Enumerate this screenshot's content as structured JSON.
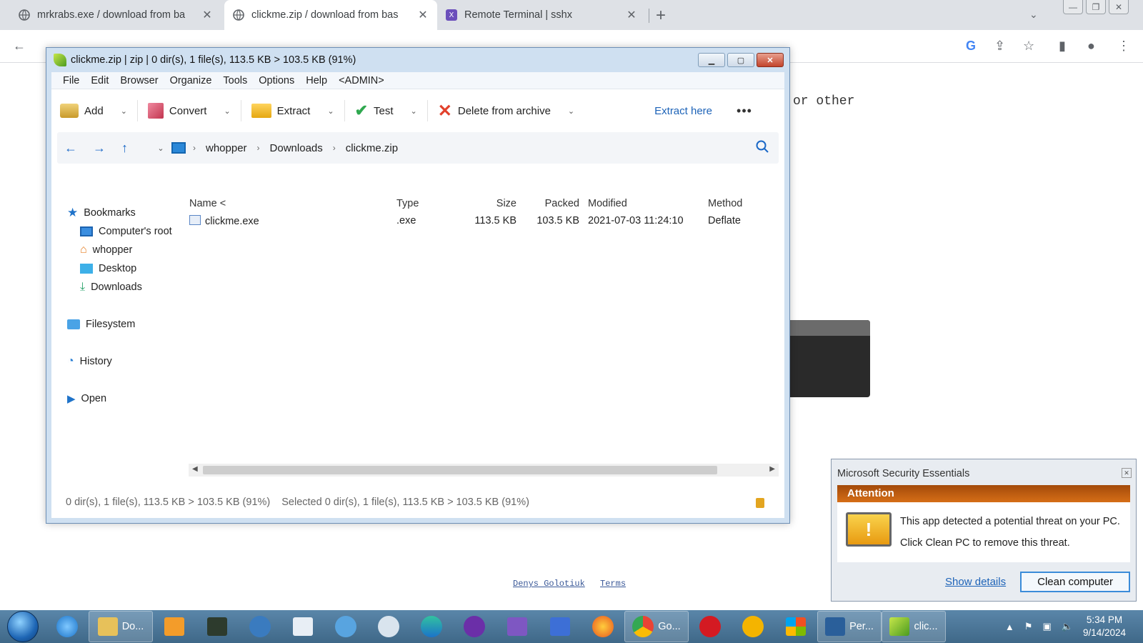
{
  "browser": {
    "tabs": [
      {
        "title": "mrkrabs.exe / download from ba",
        "active": false
      },
      {
        "title": "clickme.zip / download from bas",
        "active": true
      },
      {
        "title": "Remote Terminal | sshx",
        "active": false
      }
    ]
  },
  "page": {
    "partial_text": "or other",
    "footer_links": [
      "Denys Golotiuk",
      "Terms"
    ]
  },
  "archive_window": {
    "title": "clickme.zip | zip | 0 dir(s), 1 file(s), 113.5 KB > 103.5 KB (91%)",
    "menu": [
      "File",
      "Edit",
      "Browser",
      "Organize",
      "Tools",
      "Options",
      "Help",
      "<ADMIN>"
    ],
    "ribbon": {
      "add": "Add",
      "convert": "Convert",
      "extract": "Extract",
      "test": "Test",
      "delete": "Delete from archive",
      "extract_here": "Extract here"
    },
    "breadcrumb": [
      "whopper",
      "Downloads",
      "clickme.zip"
    ],
    "sidebar": {
      "bookmarks": "Bookmarks",
      "bookmark_items": [
        "Computer's root",
        "whopper",
        "Desktop",
        "Downloads"
      ],
      "filesystem": "Filesystem",
      "history": "History",
      "open": "Open"
    },
    "columns": {
      "name": "Name <",
      "type": "Type",
      "size": "Size",
      "packed": "Packed",
      "modified": "Modified",
      "method": "Method"
    },
    "files": [
      {
        "name": "clickme.exe",
        "type": ".exe",
        "size": "113.5 KB",
        "packed": "103.5 KB",
        "modified": "2021-07-03 11:24:10",
        "method": "Deflate"
      }
    ],
    "status": {
      "left": "0 dir(s), 1 file(s), 113.5 KB > 103.5 KB (91%)",
      "selected": "Selected 0 dir(s), 1 file(s), 113.5 KB > 103.5 KB (91%)"
    }
  },
  "mse_popup": {
    "title": "Microsoft Security Essentials",
    "heading": "Attention",
    "line1": "This app detected a potential threat on your PC.",
    "line2": "Click Clean PC to remove this threat.",
    "show_details": "Show details",
    "clean_button": "Clean computer"
  },
  "taskbar": {
    "apps": [
      "Do...",
      "Go...",
      "Per...",
      "clic..."
    ],
    "time": "5:34 PM",
    "date": "9/14/2024"
  }
}
